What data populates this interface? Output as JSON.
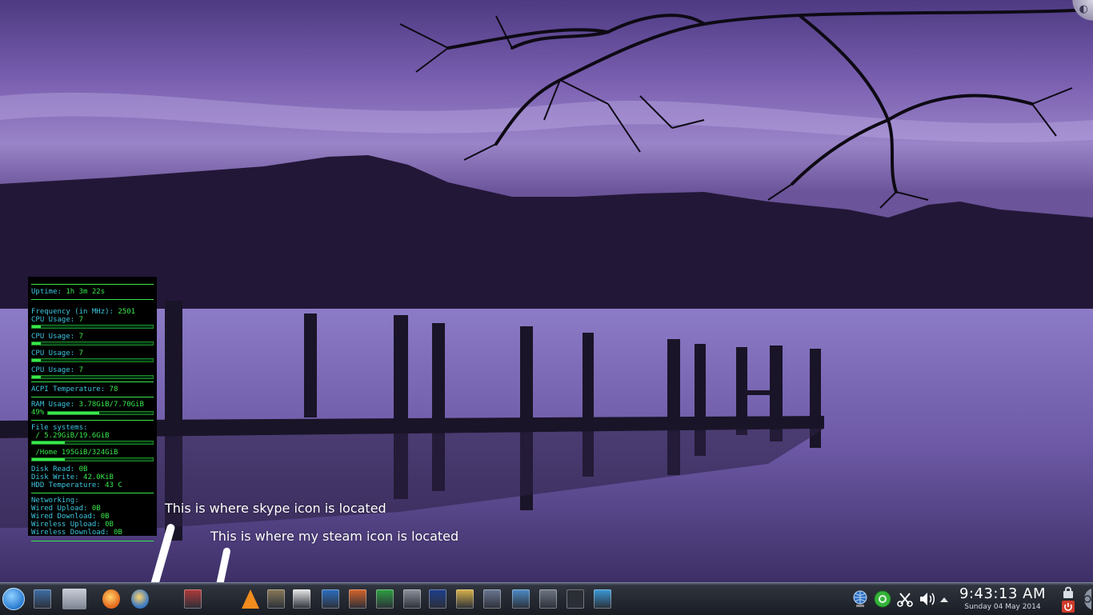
{
  "monitor": {
    "uptime_label": "Uptime:",
    "uptime_value": "1h 3m 22s",
    "freq_label": "Frequency (in MHz):",
    "freq_value": "2501",
    "cpu_label": "CPU Usage:",
    "cpus": [
      "7",
      "7",
      "7",
      "7"
    ],
    "cpu_fraction": 0.07,
    "acpi_label": "ACPI Temperature:",
    "acpi_value": "78",
    "ram_label": "RAM Usage:",
    "ram_value": "3.78GiB/7.70GiB",
    "ram_pct": "49%",
    "ram_fraction": 0.49,
    "fs_label": "File systems:",
    "fs_root": " / 5.29GiB/19.6GiB",
    "fs_root_fraction": 0.27,
    "fs_home": " /Home 195GiB/324GiB",
    "fs_home_fraction": 0.27,
    "disk_read_label": "Disk Read:",
    "disk_read_value": "0B",
    "disk_write_label": "Disk Write:",
    "disk_write_value": "42.0KiB",
    "hdd_temp_label": "HDD Temperature:",
    "hdd_temp_value": "43 C",
    "net_label": "Networking:",
    "wired_up_label": "Wired Upload:",
    "wired_up_value": "0B",
    "wired_down_label": "Wired Download:",
    "wired_down_value": "0B",
    "wifi_up_label": "Wireless Upload:",
    "wifi_up_value": "0B",
    "wifi_down_label": "Wireless Download:",
    "wifi_down_value": "0B"
  },
  "annotations": {
    "skype": "This is where skype icon is located",
    "steam": "This is where my steam icon is located"
  },
  "taskbar": {
    "launchers": [
      {
        "name": "kde-menu-icon",
        "color": "#2a7bd0"
      },
      {
        "name": "desktop-icon",
        "color": "#3f6fa8"
      },
      {
        "name": "file-manager-icon",
        "color": "#c9ced8"
      },
      {
        "name": "firefox-icon",
        "color": "#e66a1f"
      },
      {
        "name": "thunderbird-icon",
        "color": "#3a78c2"
      },
      {
        "name": "hidden-skype-icon",
        "color": "#ffffff"
      },
      {
        "name": "install-icon",
        "color": "#b23a3a"
      },
      {
        "name": "hidden-steam-icon",
        "color": "#ffffff"
      },
      {
        "name": "vlc-icon",
        "color": "#f28c1e"
      },
      {
        "name": "gimp-icon",
        "color": "#8a7a5a"
      },
      {
        "name": "text-editor-icon",
        "color": "#e8e8e8"
      },
      {
        "name": "writer-icon",
        "color": "#2d6fc1"
      },
      {
        "name": "impress-icon",
        "color": "#d8642a"
      },
      {
        "name": "calc-icon",
        "color": "#2fa043"
      },
      {
        "name": "calculator-icon",
        "color": "#8d929c"
      },
      {
        "name": "aussie-game-icon",
        "color": "#1e3e8c"
      },
      {
        "name": "settings-tools-icon",
        "color": "#d9b34a"
      },
      {
        "name": "game-controller-icon",
        "color": "#6c7894"
      },
      {
        "name": "package-manager-icon",
        "color": "#4d8cc8"
      },
      {
        "name": "monitor-icon",
        "color": "#6f7784"
      },
      {
        "name": "terminal-icon",
        "color": "#2a2d33"
      },
      {
        "name": "system-monitor-icon",
        "color": "#3a9ad8"
      }
    ],
    "tray": {
      "network_icon": "globe-network-icon",
      "status_icon": "green-status-icon",
      "clipboard_icon": "scissors-icon",
      "volume_icon": "speaker-icon",
      "expand_icon": "up-arrow-icon"
    },
    "clock": {
      "time": "9:43:13 AM",
      "date": "Sunday 04 May 2014"
    }
  }
}
